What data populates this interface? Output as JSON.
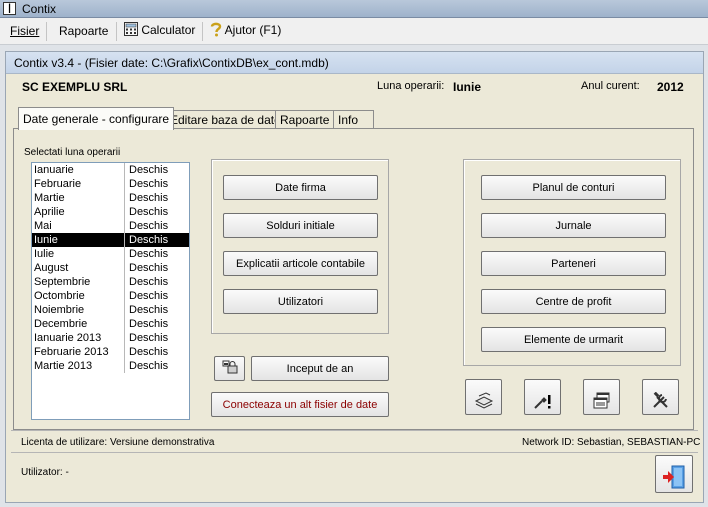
{
  "window": {
    "title": "Contix"
  },
  "menu": {
    "fisier": "Fisier",
    "rapoarte": "Rapoarte",
    "calculator": "Calculator",
    "ajutor": "Ajutor (F1)"
  },
  "form": {
    "title": "Contix v3.4 - (Fisier date: C:\\Grafix\\ContixDB\\ex_cont.mdb)",
    "company": "SC EXEMPLU SRL",
    "luna_label": "Luna operarii:",
    "luna_value": "Iunie",
    "anul_label": "Anul curent:",
    "anul_value": "2012"
  },
  "tabs": [
    {
      "label": "Date generale - configurare"
    },
    {
      "label": "Editare baza de date"
    },
    {
      "label": "Rapoarte"
    },
    {
      "label": "Info"
    }
  ],
  "months": {
    "label": "Selectati luna operarii",
    "selected_index": 5,
    "items": [
      {
        "name": "Ianuarie",
        "status": "Deschis"
      },
      {
        "name": "Februarie",
        "status": "Deschis"
      },
      {
        "name": "Martie",
        "status": "Deschis"
      },
      {
        "name": "Aprilie",
        "status": "Deschis"
      },
      {
        "name": "Mai",
        "status": "Deschis"
      },
      {
        "name": "Iunie",
        "status": "Deschis"
      },
      {
        "name": "Iulie",
        "status": "Deschis"
      },
      {
        "name": "August",
        "status": "Deschis"
      },
      {
        "name": "Septembrie",
        "status": "Deschis"
      },
      {
        "name": "Octombrie",
        "status": "Deschis"
      },
      {
        "name": "Noiembrie",
        "status": "Deschis"
      },
      {
        "name": "Decembrie",
        "status": "Deschis"
      },
      {
        "name": "Ianuarie 2013",
        "status": "Deschis"
      },
      {
        "name": "Februarie 2013",
        "status": "Deschis"
      },
      {
        "name": "Martie 2013",
        "status": "Deschis"
      }
    ]
  },
  "buttons": {
    "date_firma": "Date firma",
    "solduri": "Solduri initiale",
    "explicatii": "Explicatii articole contabile",
    "utilizatori": "Utilizatori",
    "inceput": "Inceput de an",
    "conecteaza": "Conecteaza un alt fisier de date",
    "plan": "Planul de conturi",
    "jurnale": "Jurnale",
    "parteneri": "Parteneri",
    "centre": "Centre de profit",
    "elemente": "Elemente de urmarit"
  },
  "footer": {
    "license": "Licenta de utilizare: Versiune demonstrativa",
    "network": "Network ID: Sebastian, SEBASTIAN-PC",
    "user": "Utilizator: -"
  },
  "colors": {
    "selected_row": "#000000",
    "danger_text": "#8b0000"
  }
}
